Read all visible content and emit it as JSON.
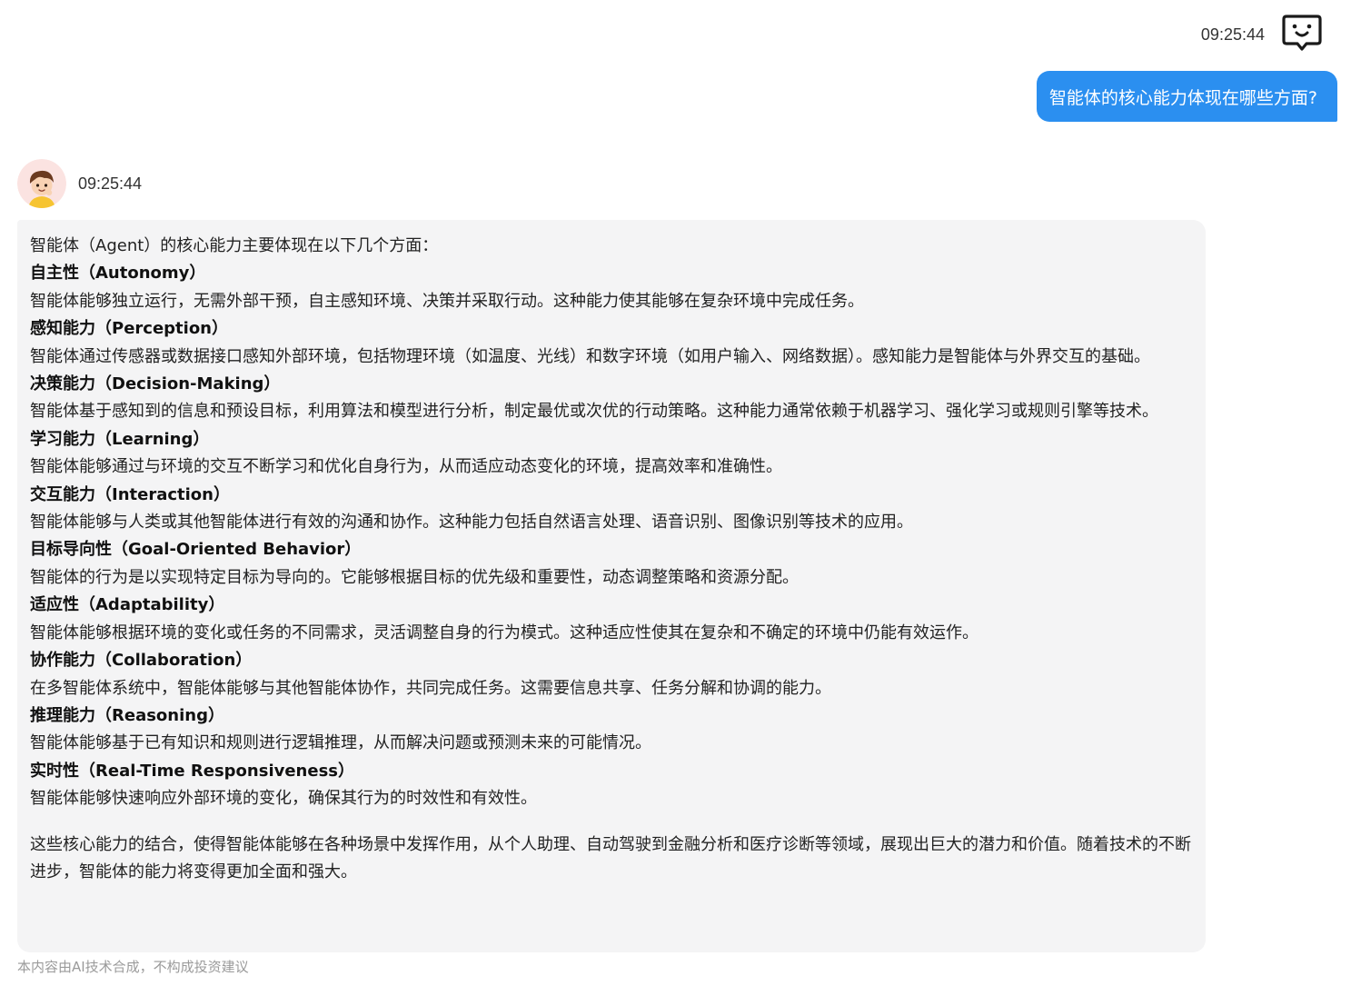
{
  "user_message": {
    "time": "09:25:44",
    "text": "智能体的核心能力体现在哪些方面?",
    "avatar_icon": "chat-bubble-face-icon",
    "bubble_color": "#2b8ff0"
  },
  "bot_message": {
    "time": "09:25:44",
    "avatar_icon": "cartoon-boy-avatar",
    "intro": "智能体（Agent）的核心能力主要体现在以下几个方面：",
    "sections": [
      {
        "title": "自主性（Autonomy）",
        "body": "智能体能够独立运行，无需外部干预，自主感知环境、决策并采取行动。这种能力使其能够在复杂环境中完成任务。"
      },
      {
        "title": "感知能力（Perception）",
        "body": "智能体通过传感器或数据接口感知外部环境，包括物理环境（如温度、光线）和数字环境（如用户输入、网络数据）。感知能力是智能体与外界交互的基础。"
      },
      {
        "title": "决策能力（Decision-Making）",
        "body": "智能体基于感知到的信息和预设目标，利用算法和模型进行分析，制定最优或次优的行动策略。这种能力通常依赖于机器学习、强化学习或规则引擎等技术。"
      },
      {
        "title": "学习能力（Learning）",
        "body": "智能体能够通过与环境的交互不断学习和优化自身行为，从而适应动态变化的环境，提高效率和准确性。"
      },
      {
        "title": "交互能力（Interaction）",
        "body": "智能体能够与人类或其他智能体进行有效的沟通和协作。这种能力包括自然语言处理、语音识别、图像识别等技术的应用。"
      },
      {
        "title": "目标导向性（Goal-Oriented Behavior）",
        "body": "智能体的行为是以实现特定目标为导向的。它能够根据目标的优先级和重要性，动态调整策略和资源分配。"
      },
      {
        "title": "适应性（Adaptability）",
        "body": "智能体能够根据环境的变化或任务的不同需求，灵活调整自身的行为模式。这种适应性使其在复杂和不确定的环境中仍能有效运作。"
      },
      {
        "title": "协作能力（Collaboration）",
        "body": "在多智能体系统中，智能体能够与其他智能体协作，共同完成任务。这需要信息共享、任务分解和协调的能力。"
      },
      {
        "title": "推理能力（Reasoning）",
        "body": "智能体能够基于已有知识和规则进行逻辑推理，从而解决问题或预测未来的可能情况。"
      },
      {
        "title": "实时性（Real-Time Responsiveness）",
        "body": "智能体能够快速响应外部环境的变化，确保其行为的时效性和有效性。"
      }
    ],
    "conclusion": "这些核心能力的结合，使得智能体能够在各种场景中发挥作用，从个人助理、自动驾驶到金融分析和医疗诊断等领域，展现出巨大的潜力和价值。随着技术的不断进步，智能体的能力将变得更加全面和强大。",
    "bubble_color": "#f4f4f5"
  },
  "disclaimer": "本内容由AI技术合成，不构成投资建议"
}
